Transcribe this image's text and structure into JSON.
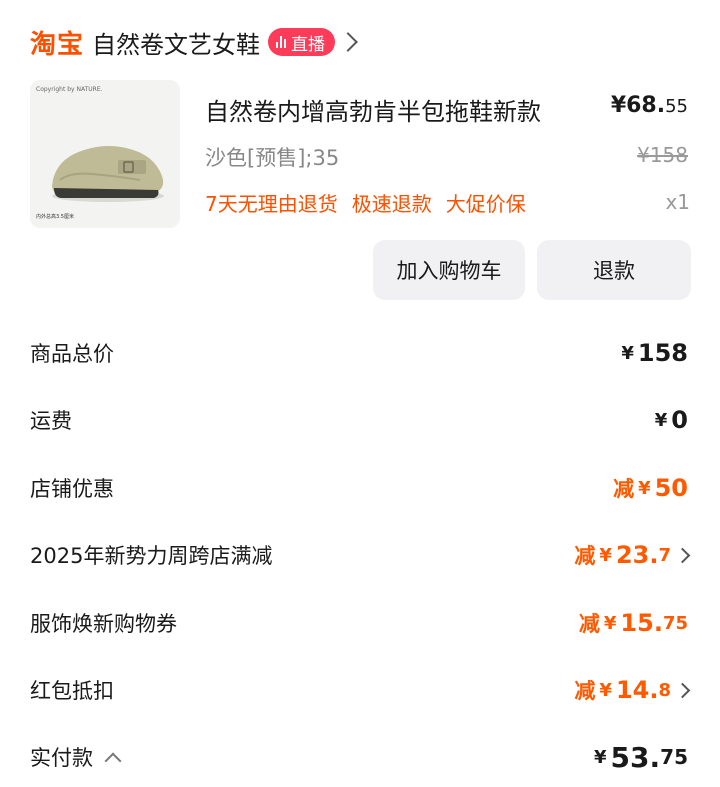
{
  "header": {
    "logo": "淘宝",
    "shop_name": "自然卷文艺女鞋",
    "live_badge": "直播"
  },
  "product": {
    "title": "自然卷内增高勃肯半包拖鞋新款",
    "thumb_caption": "Copyright by NATURE.",
    "thumb_footer": "内外总高3.5厘米",
    "price_main": "¥68.",
    "price_decimal": "55",
    "sku": "沙色[预售];35",
    "original_price": "¥158",
    "tags": [
      "7天无理由退货",
      "极速退款",
      "大促价保"
    ],
    "quantity": "x1"
  },
  "actions": {
    "add_to_cart": "加入购物车",
    "refund": "退款"
  },
  "summary": [
    {
      "label": "商品总价",
      "prefix": "",
      "yen": "¥",
      "int": "158",
      "dec": "",
      "orange": false,
      "chevron": false
    },
    {
      "label": "运费",
      "prefix": "",
      "yen": "¥",
      "int": "0",
      "dec": "",
      "orange": false,
      "chevron": false
    },
    {
      "label": "店铺优惠",
      "prefix": "减",
      "yen": "¥",
      "int": "50",
      "dec": "",
      "orange": true,
      "chevron": false
    },
    {
      "label": "2025年新势力周跨店满减",
      "prefix": "减",
      "yen": "¥",
      "int": "23.",
      "dec": "7",
      "orange": true,
      "chevron": true
    },
    {
      "label": "服饰焕新购物券",
      "prefix": "减",
      "yen": "¥",
      "int": "15.",
      "dec": "75",
      "orange": true,
      "chevron": false
    },
    {
      "label": "红包抵扣",
      "prefix": "减",
      "yen": "¥",
      "int": "14.",
      "dec": "8",
      "orange": true,
      "chevron": true
    }
  ],
  "total": {
    "label": "实付款",
    "yen": "¥",
    "int": "53.",
    "dec": "75"
  },
  "colors": {
    "brand": "#ff5000",
    "discount": "#ff5a00",
    "live": "#ff3b5a"
  }
}
